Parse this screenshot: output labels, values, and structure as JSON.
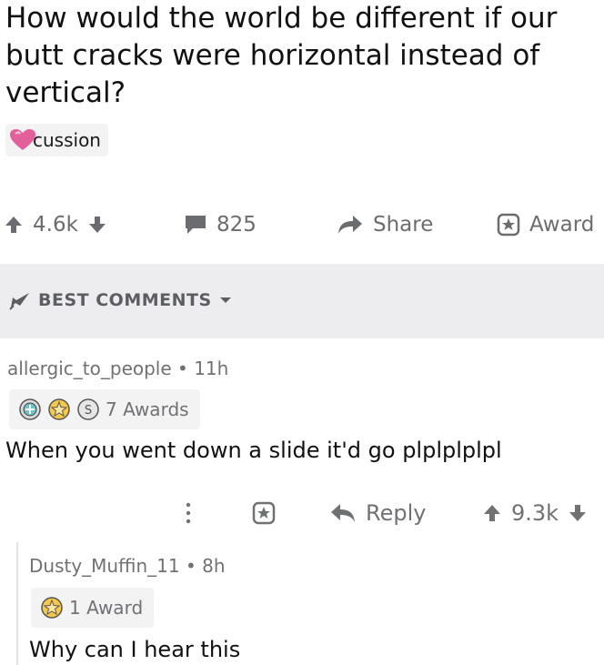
{
  "post": {
    "title": "How would the world be different if our butt cracks were horizontal instead of vertical?",
    "flair": "cussion",
    "upvotes": "4.6k",
    "comments": "825",
    "share_label": "Share",
    "award_label": "Award"
  },
  "sort": {
    "label": "BEST COMMENTS"
  },
  "comments": [
    {
      "author": "allergic_to_people",
      "age": "11h",
      "awards": "7 Awards",
      "body": "When you went down a slide it'd go plplplplpl",
      "reply_label": "Reply",
      "score": "9.3k"
    },
    {
      "author": "Dusty_Muffin_11",
      "age": "8h",
      "awards": "1 Award",
      "body": "Why can I hear this"
    }
  ],
  "colors": {
    "text": "#1a1a1b",
    "meta": "#6f7173",
    "bar_bg": "#ededef",
    "pill_bg": "#f3f3f4",
    "heart": "#e3609a"
  }
}
